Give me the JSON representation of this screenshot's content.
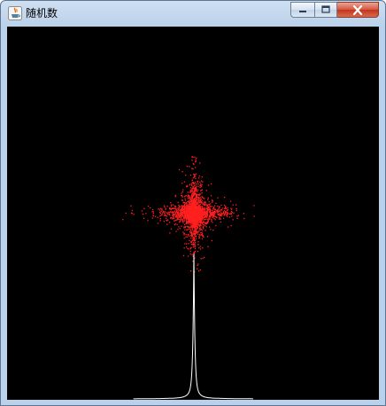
{
  "window": {
    "title": "随机数",
    "icon": "java-coffee-cup-icon",
    "buttons": {
      "minimize": "minimize-icon",
      "maximize": "maximize-icon",
      "close": "close-icon"
    }
  },
  "canvas": {
    "background": "#000000",
    "scatter_color": "#ff2020",
    "histogram_color": "#ffffff"
  }
}
